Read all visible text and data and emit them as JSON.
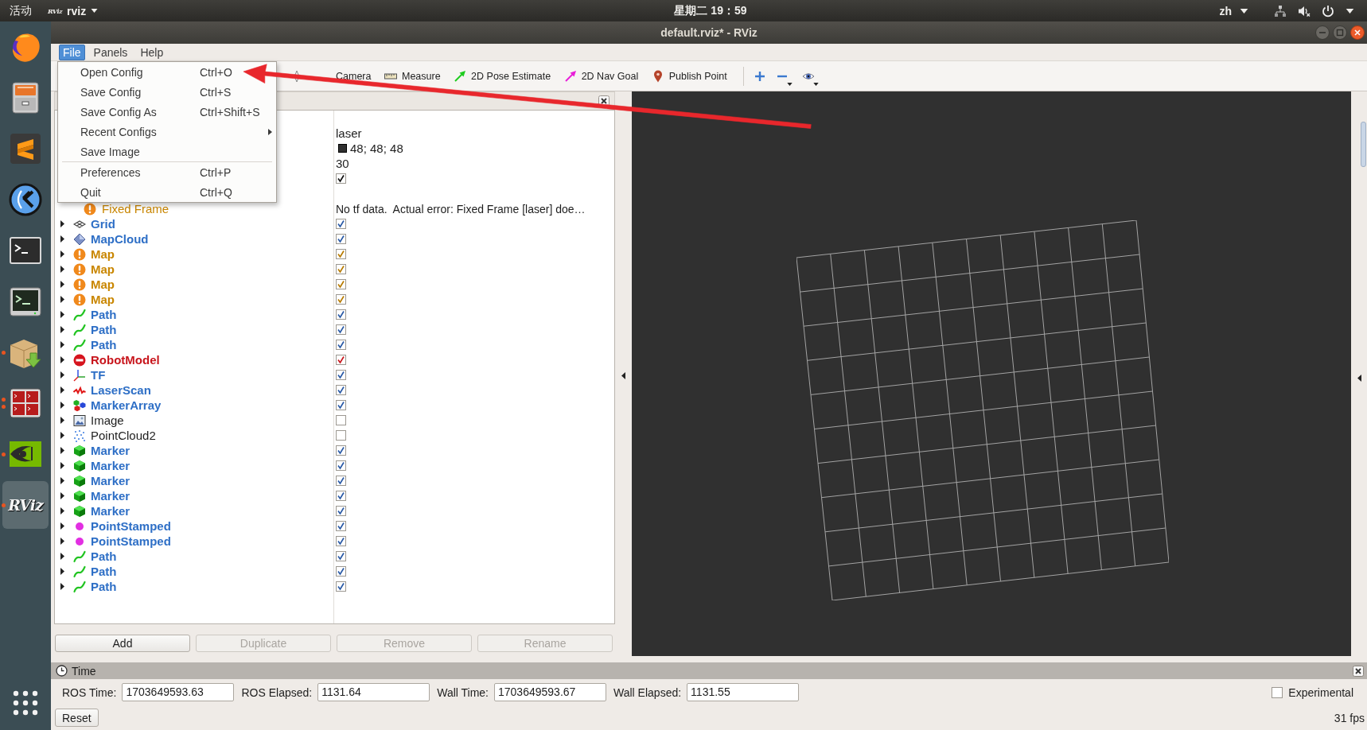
{
  "top_bar": {
    "activities": "活动",
    "app_menu": {
      "logo": "RViz",
      "label": "rviz"
    },
    "clock": "星期二 19：59",
    "input_method": "zh"
  },
  "dock": {
    "items": [
      {
        "kind": "globe",
        "running": false,
        "multi_window": false,
        "selected": false
      },
      {
        "kind": "cabinet",
        "running": false,
        "multi_window": false,
        "selected": false
      },
      {
        "kind": "s_tile",
        "running": false,
        "multi_window": false,
        "selected": false
      },
      {
        "kind": "circle_logo",
        "running": false,
        "multi_window": false,
        "selected": false
      },
      {
        "kind": "terminal",
        "running": false,
        "multi_window": false,
        "selected": false
      },
      {
        "kind": "monitor_terminal",
        "running": false,
        "multi_window": false,
        "selected": false
      },
      {
        "kind": "package",
        "running": true,
        "multi_window": false,
        "selected": false
      },
      {
        "kind": "split_terminal",
        "running": true,
        "multi_window": true,
        "selected": false
      },
      {
        "kind": "eye_logo",
        "running": true,
        "multi_window": false,
        "selected": false
      },
      {
        "kind": "text_logo",
        "label": "RViz",
        "running": true,
        "multi_window": false,
        "selected": true
      }
    ]
  },
  "window": {
    "title": "default.rviz* - RViz"
  },
  "menu_bar": [
    {
      "label": "File",
      "selected": true
    },
    {
      "label": "Panels",
      "selected": false
    },
    {
      "label": "Help",
      "selected": false
    }
  ],
  "file_menu": [
    {
      "kind": "item",
      "label": "Open Config",
      "shortcut": "Ctrl+O"
    },
    {
      "kind": "item",
      "label": "Save Config",
      "shortcut": "Ctrl+S"
    },
    {
      "kind": "item",
      "label": "Save Config As",
      "shortcut": "Ctrl+Shift+S"
    },
    {
      "kind": "submenu",
      "label": "Recent Configs"
    },
    {
      "kind": "item",
      "label": "Save Image"
    },
    {
      "kind": "separator"
    },
    {
      "kind": "item",
      "label": "Preferences",
      "shortcut": "Ctrl+P"
    },
    {
      "kind": "item",
      "label": "Quit",
      "shortcut": "Ctrl+Q"
    }
  ],
  "toolbar": [
    {
      "kind": "focus",
      "label": "Camera"
    },
    {
      "kind": "measure",
      "label": "Measure"
    },
    {
      "kind": "pose",
      "label": "2D Pose Estimate"
    },
    {
      "kind": "goal",
      "label": "2D Nav Goal"
    },
    {
      "kind": "point",
      "label": "Publish Point"
    },
    {
      "kind": "separator"
    },
    {
      "kind": "add_tool",
      "menu": false
    },
    {
      "kind": "remove_tool",
      "menu": true
    },
    {
      "kind": "tool_views",
      "menu": true
    }
  ],
  "displays_panel": {
    "global_values": [
      {
        "kind": "text",
        "value": "laser"
      },
      {
        "kind": "color",
        "color": "#303030",
        "value": "48; 48; 48"
      },
      {
        "kind": "text",
        "value": "30"
      },
      {
        "kind": "checkbox",
        "checked": true
      }
    ],
    "status": {
      "kind": "warning",
      "label": "Fixed Frame",
      "message": "No tf data.  Actual error: Fixed Frame [laser] doe…"
    },
    "displays": [
      {
        "name": "Grid",
        "kind": "grid",
        "checked": true,
        "expanded": false
      },
      {
        "name": "MapCloud",
        "kind": "map_cloud",
        "checked": true,
        "expanded": false
      },
      {
        "name": "Map",
        "kind": "warning",
        "checked": true,
        "expanded": false
      },
      {
        "name": "Map",
        "kind": "warning",
        "checked": true,
        "expanded": false
      },
      {
        "name": "Map",
        "kind": "warning",
        "checked": true,
        "expanded": false
      },
      {
        "name": "Map",
        "kind": "warning",
        "checked": true,
        "expanded": false
      },
      {
        "name": "Path",
        "kind": "path",
        "checked": true,
        "expanded": false
      },
      {
        "name": "Path",
        "kind": "path",
        "checked": true,
        "expanded": false
      },
      {
        "name": "Path",
        "kind": "path",
        "checked": true,
        "expanded": false
      },
      {
        "name": "RobotModel",
        "kind": "error",
        "checked": true,
        "expanded": false
      },
      {
        "name": "TF",
        "kind": "tf",
        "checked": true,
        "expanded": false
      },
      {
        "name": "LaserScan",
        "kind": "laser_scan",
        "checked": true,
        "expanded": false
      },
      {
        "name": "MarkerArray",
        "kind": "marker_array",
        "checked": true,
        "expanded": false
      },
      {
        "name": "Image",
        "kind": "image",
        "checked": false,
        "expanded": false
      },
      {
        "name": "PointCloud2",
        "kind": "point_cloud",
        "checked": false,
        "expanded": false
      },
      {
        "name": "Marker",
        "kind": "marker",
        "checked": true,
        "expanded": false
      },
      {
        "name": "Marker",
        "kind": "marker",
        "checked": true,
        "expanded": false
      },
      {
        "name": "Marker",
        "kind": "marker",
        "checked": true,
        "expanded": false
      },
      {
        "name": "Marker",
        "kind": "marker",
        "checked": true,
        "expanded": false
      },
      {
        "name": "Marker",
        "kind": "marker",
        "checked": true,
        "expanded": false
      },
      {
        "name": "PointStamped",
        "kind": "point",
        "checked": true,
        "expanded": false
      },
      {
        "name": "PointStamped",
        "kind": "point",
        "checked": true,
        "expanded": false
      },
      {
        "name": "Path",
        "kind": "path",
        "checked": true,
        "expanded": false
      },
      {
        "name": "Path",
        "kind": "path",
        "checked": true,
        "expanded": false
      },
      {
        "name": "Path",
        "kind": "path",
        "checked": true,
        "expanded": false
      }
    ],
    "buttons": [
      {
        "label": "Add",
        "disabled": false
      },
      {
        "label": "Duplicate",
        "disabled": true
      },
      {
        "label": "Remove",
        "disabled": true
      },
      {
        "label": "Rename",
        "disabled": true
      }
    ]
  },
  "time_panel": {
    "title": "Time",
    "fields": [
      {
        "label": "ROS Time:",
        "value": "1703649593.63"
      },
      {
        "label": "ROS Elapsed:",
        "value": "1131.64"
      },
      {
        "label": "Wall Time:",
        "value": "1703649593.67"
      },
      {
        "label": "Wall Elapsed:",
        "value": "1131.55"
      }
    ],
    "experimental": {
      "label": "Experimental",
      "checked": false
    },
    "reset": "Reset"
  },
  "status_bar": {
    "fps": "31 fps"
  }
}
